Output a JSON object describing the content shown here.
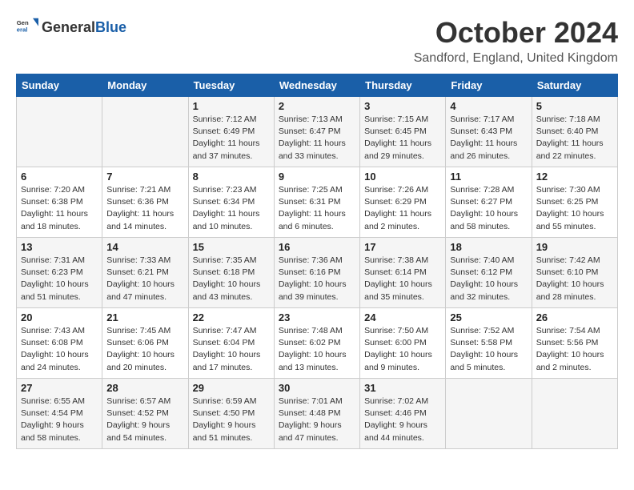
{
  "header": {
    "logo_general": "General",
    "logo_blue": "Blue",
    "month": "October 2024",
    "location": "Sandford, England, United Kingdom"
  },
  "days_of_week": [
    "Sunday",
    "Monday",
    "Tuesday",
    "Wednesday",
    "Thursday",
    "Friday",
    "Saturday"
  ],
  "weeks": [
    [
      {
        "day": "",
        "info": ""
      },
      {
        "day": "",
        "info": ""
      },
      {
        "day": "1",
        "info": "Sunrise: 7:12 AM\nSunset: 6:49 PM\nDaylight: 11 hours and 37 minutes."
      },
      {
        "day": "2",
        "info": "Sunrise: 7:13 AM\nSunset: 6:47 PM\nDaylight: 11 hours and 33 minutes."
      },
      {
        "day": "3",
        "info": "Sunrise: 7:15 AM\nSunset: 6:45 PM\nDaylight: 11 hours and 29 minutes."
      },
      {
        "day": "4",
        "info": "Sunrise: 7:17 AM\nSunset: 6:43 PM\nDaylight: 11 hours and 26 minutes."
      },
      {
        "day": "5",
        "info": "Sunrise: 7:18 AM\nSunset: 6:40 PM\nDaylight: 11 hours and 22 minutes."
      }
    ],
    [
      {
        "day": "6",
        "info": "Sunrise: 7:20 AM\nSunset: 6:38 PM\nDaylight: 11 hours and 18 minutes."
      },
      {
        "day": "7",
        "info": "Sunrise: 7:21 AM\nSunset: 6:36 PM\nDaylight: 11 hours and 14 minutes."
      },
      {
        "day": "8",
        "info": "Sunrise: 7:23 AM\nSunset: 6:34 PM\nDaylight: 11 hours and 10 minutes."
      },
      {
        "day": "9",
        "info": "Sunrise: 7:25 AM\nSunset: 6:31 PM\nDaylight: 11 hours and 6 minutes."
      },
      {
        "day": "10",
        "info": "Sunrise: 7:26 AM\nSunset: 6:29 PM\nDaylight: 11 hours and 2 minutes."
      },
      {
        "day": "11",
        "info": "Sunrise: 7:28 AM\nSunset: 6:27 PM\nDaylight: 10 hours and 58 minutes."
      },
      {
        "day": "12",
        "info": "Sunrise: 7:30 AM\nSunset: 6:25 PM\nDaylight: 10 hours and 55 minutes."
      }
    ],
    [
      {
        "day": "13",
        "info": "Sunrise: 7:31 AM\nSunset: 6:23 PM\nDaylight: 10 hours and 51 minutes."
      },
      {
        "day": "14",
        "info": "Sunrise: 7:33 AM\nSunset: 6:21 PM\nDaylight: 10 hours and 47 minutes."
      },
      {
        "day": "15",
        "info": "Sunrise: 7:35 AM\nSunset: 6:18 PM\nDaylight: 10 hours and 43 minutes."
      },
      {
        "day": "16",
        "info": "Sunrise: 7:36 AM\nSunset: 6:16 PM\nDaylight: 10 hours and 39 minutes."
      },
      {
        "day": "17",
        "info": "Sunrise: 7:38 AM\nSunset: 6:14 PM\nDaylight: 10 hours and 35 minutes."
      },
      {
        "day": "18",
        "info": "Sunrise: 7:40 AM\nSunset: 6:12 PM\nDaylight: 10 hours and 32 minutes."
      },
      {
        "day": "19",
        "info": "Sunrise: 7:42 AM\nSunset: 6:10 PM\nDaylight: 10 hours and 28 minutes."
      }
    ],
    [
      {
        "day": "20",
        "info": "Sunrise: 7:43 AM\nSunset: 6:08 PM\nDaylight: 10 hours and 24 minutes."
      },
      {
        "day": "21",
        "info": "Sunrise: 7:45 AM\nSunset: 6:06 PM\nDaylight: 10 hours and 20 minutes."
      },
      {
        "day": "22",
        "info": "Sunrise: 7:47 AM\nSunset: 6:04 PM\nDaylight: 10 hours and 17 minutes."
      },
      {
        "day": "23",
        "info": "Sunrise: 7:48 AM\nSunset: 6:02 PM\nDaylight: 10 hours and 13 minutes."
      },
      {
        "day": "24",
        "info": "Sunrise: 7:50 AM\nSunset: 6:00 PM\nDaylight: 10 hours and 9 minutes."
      },
      {
        "day": "25",
        "info": "Sunrise: 7:52 AM\nSunset: 5:58 PM\nDaylight: 10 hours and 5 minutes."
      },
      {
        "day": "26",
        "info": "Sunrise: 7:54 AM\nSunset: 5:56 PM\nDaylight: 10 hours and 2 minutes."
      }
    ],
    [
      {
        "day": "27",
        "info": "Sunrise: 6:55 AM\nSunset: 4:54 PM\nDaylight: 9 hours and 58 minutes."
      },
      {
        "day": "28",
        "info": "Sunrise: 6:57 AM\nSunset: 4:52 PM\nDaylight: 9 hours and 54 minutes."
      },
      {
        "day": "29",
        "info": "Sunrise: 6:59 AM\nSunset: 4:50 PM\nDaylight: 9 hours and 51 minutes."
      },
      {
        "day": "30",
        "info": "Sunrise: 7:01 AM\nSunset: 4:48 PM\nDaylight: 9 hours and 47 minutes."
      },
      {
        "day": "31",
        "info": "Sunrise: 7:02 AM\nSunset: 4:46 PM\nDaylight: 9 hours and 44 minutes."
      },
      {
        "day": "",
        "info": ""
      },
      {
        "day": "",
        "info": ""
      }
    ]
  ]
}
